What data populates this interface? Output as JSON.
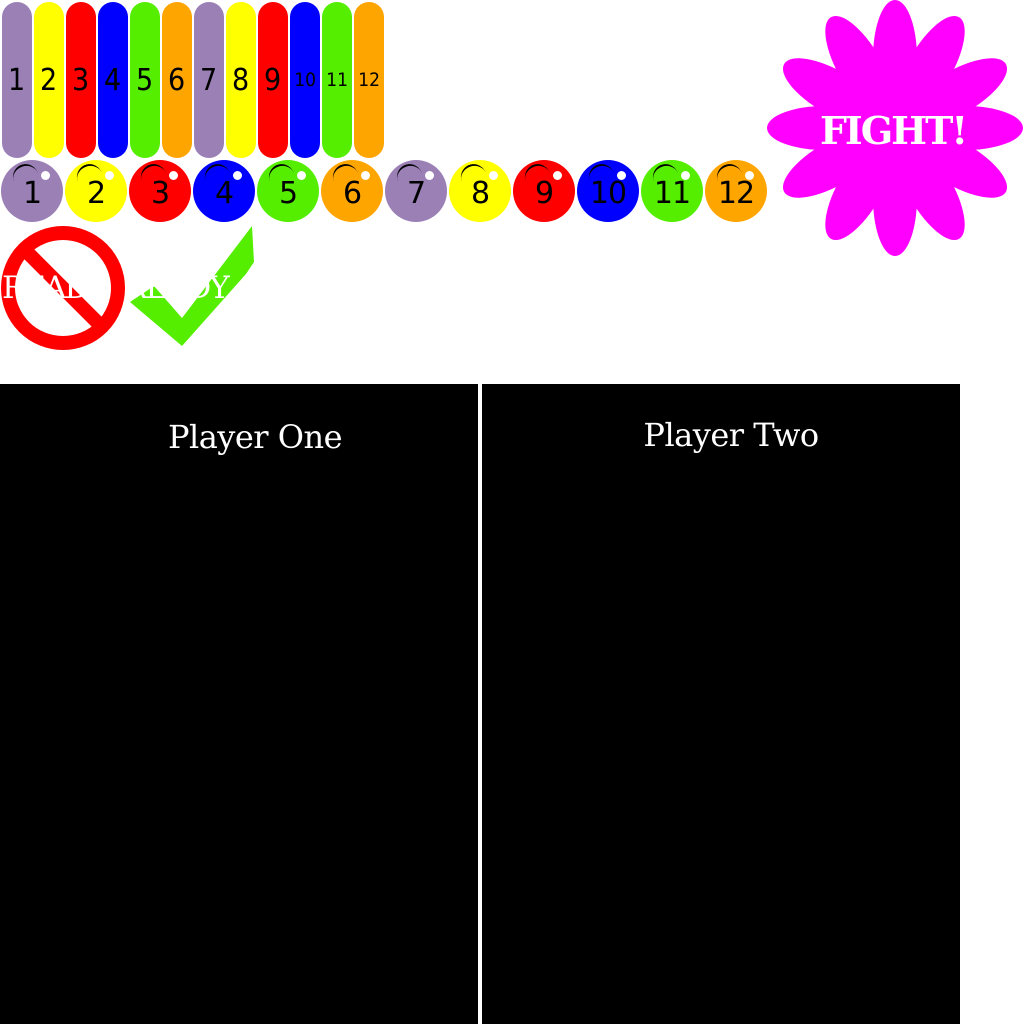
{
  "bars": [
    {
      "label": "1",
      "color": "#9b80b6"
    },
    {
      "label": "2",
      "color": "#ffff00"
    },
    {
      "label": "3",
      "color": "#ff0000"
    },
    {
      "label": "4",
      "color": "#0000ff"
    },
    {
      "label": "5",
      "color": "#55ee00"
    },
    {
      "label": "6",
      "color": "#ffa500"
    },
    {
      "label": "7",
      "color": "#9b80b6"
    },
    {
      "label": "8",
      "color": "#ffff00"
    },
    {
      "label": "9",
      "color": "#ff0000"
    },
    {
      "label": "10",
      "color": "#0000ff"
    },
    {
      "label": "11",
      "color": "#55ee00"
    },
    {
      "label": "12",
      "color": "#ffa500"
    }
  ],
  "balls": [
    {
      "label": "1",
      "color": "#9b80b6"
    },
    {
      "label": "2",
      "color": "#ffff00"
    },
    {
      "label": "3",
      "color": "#ff0000"
    },
    {
      "label": "4",
      "color": "#0000ff"
    },
    {
      "label": "5",
      "color": "#55ee00"
    },
    {
      "label": "6",
      "color": "#ffa500"
    },
    {
      "label": "7",
      "color": "#9b80b6"
    },
    {
      "label": "8",
      "color": "#ffff00"
    },
    {
      "label": "9",
      "color": "#ff0000"
    },
    {
      "label": "10",
      "color": "#0000ff"
    },
    {
      "label": "11",
      "color": "#55ee00"
    },
    {
      "label": "12",
      "color": "#ffa500"
    }
  ],
  "fight": {
    "label": "FIGHT!",
    "color": "#ff00ff",
    "icon": "flower-burst-icon"
  },
  "not_ready": {
    "label": "READY",
    "color": "#ff0000",
    "icon": "prohibited-icon"
  },
  "ready": {
    "label": "READY",
    "color": "#55ee00",
    "icon": "checkmark-icon"
  },
  "players": {
    "one": {
      "title": "Player One"
    },
    "two": {
      "title": "Player Two"
    }
  }
}
